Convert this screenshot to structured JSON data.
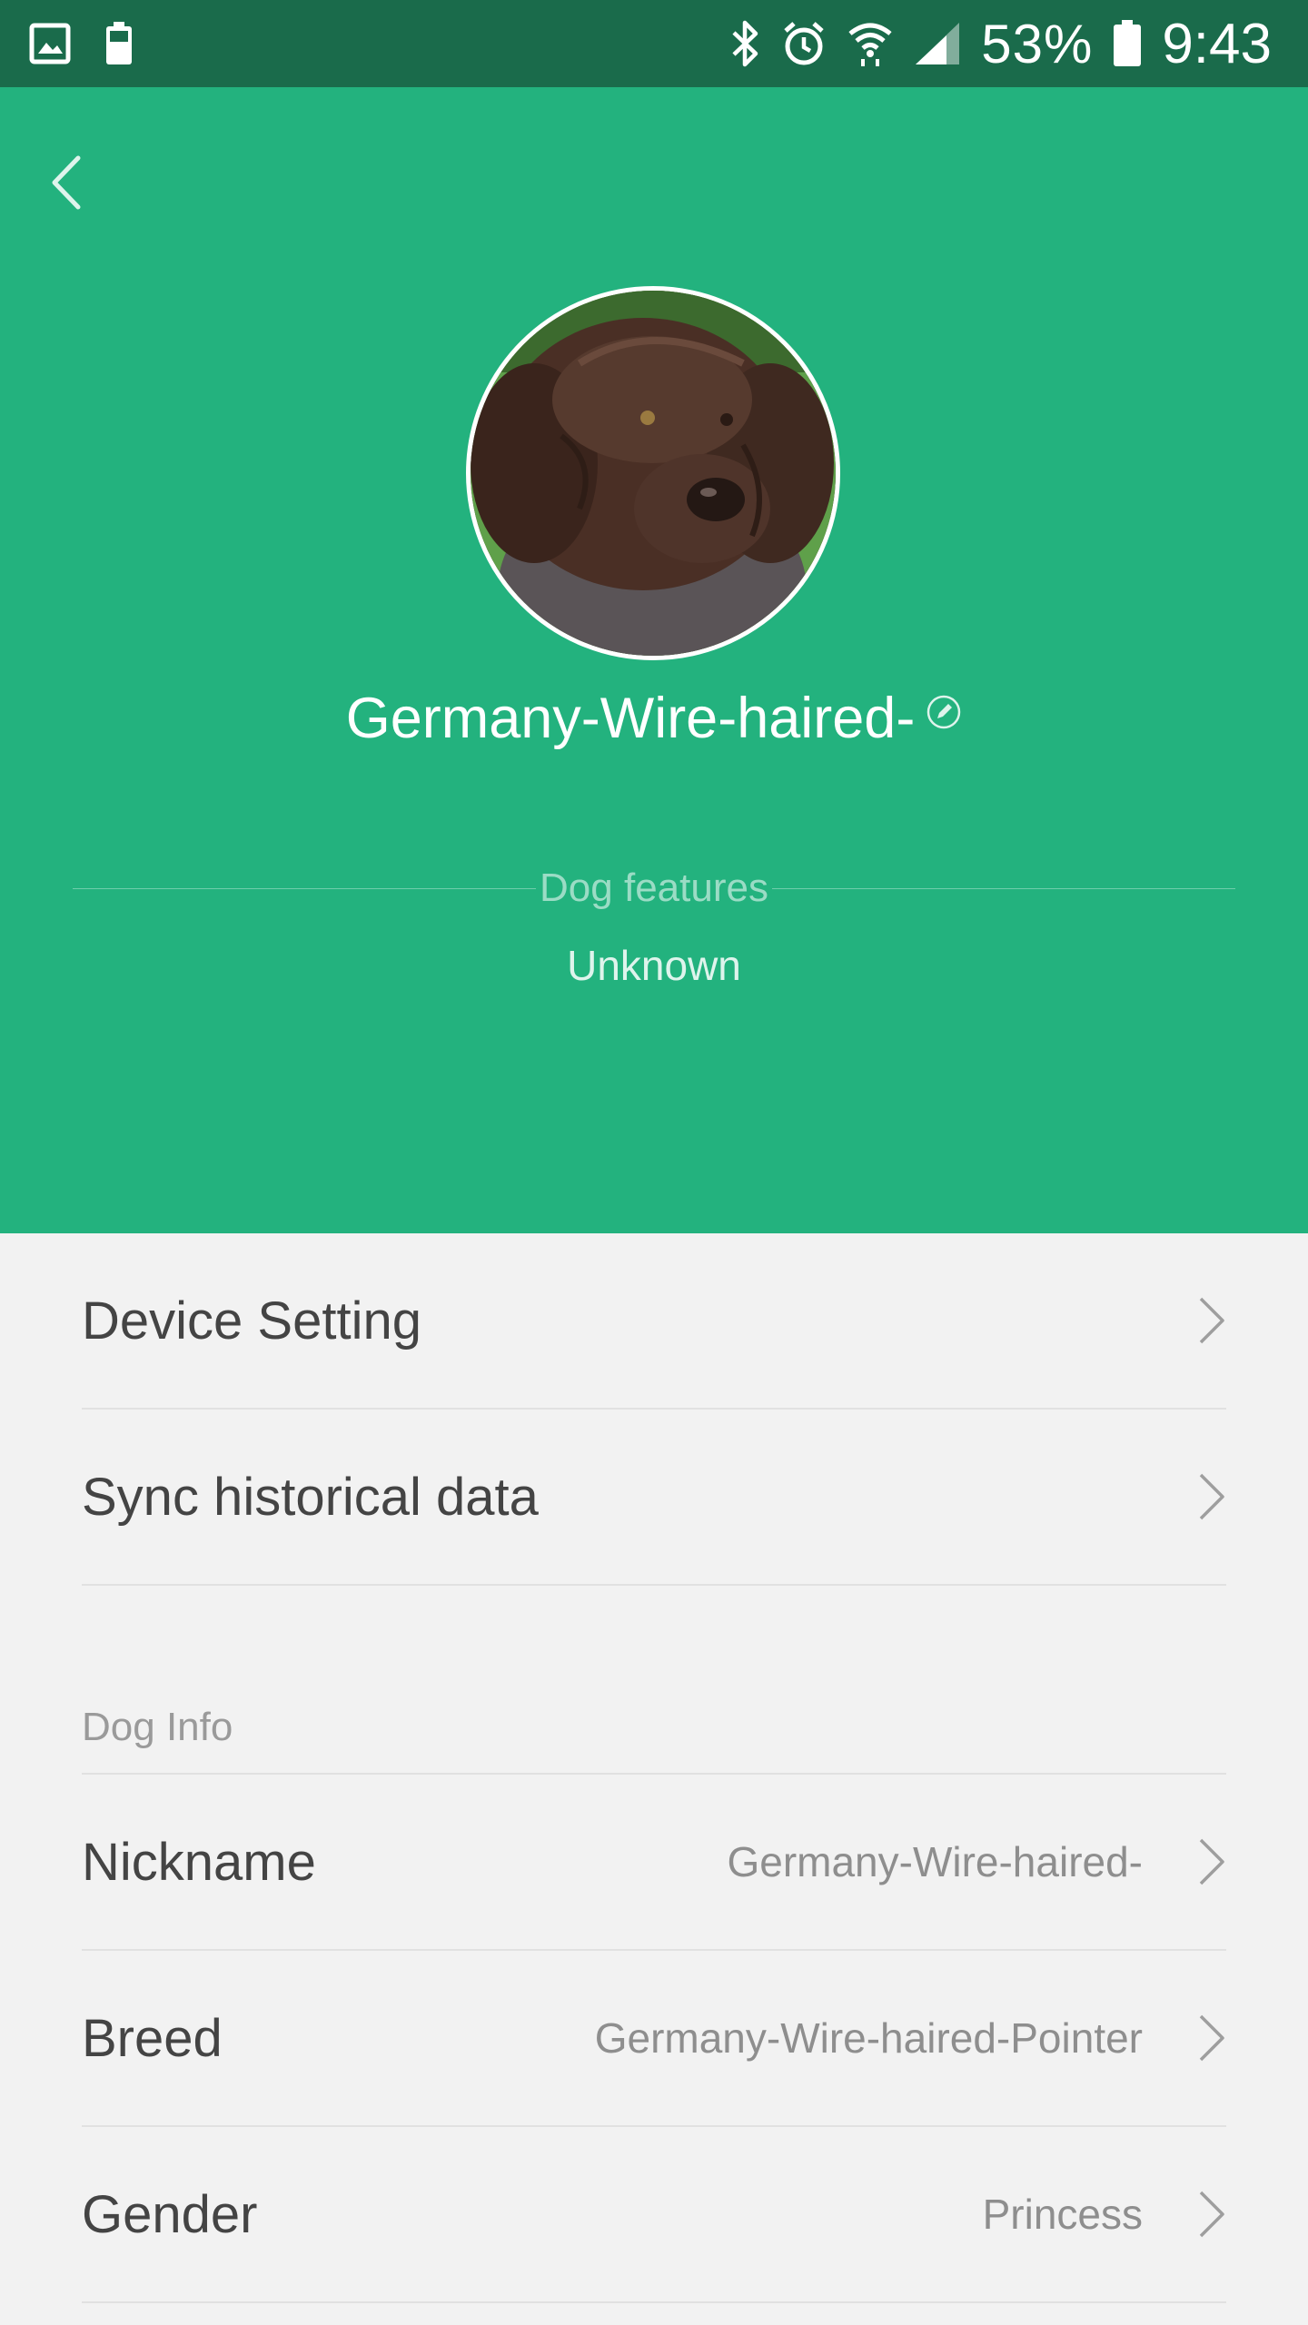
{
  "status_bar": {
    "battery_percent": "53%",
    "time": "9:43",
    "icons": [
      "gallery-icon",
      "battery-small-icon",
      "bluetooth-icon",
      "alarm-icon",
      "wifi-icon",
      "signal-icon",
      "battery-icon"
    ]
  },
  "header": {
    "background_color": "#23b27e",
    "pet_name": "Germany-Wire-haired-",
    "features_label": "Dog features",
    "features_value": "Unknown"
  },
  "list": {
    "device_setting": "Device Setting",
    "sync_historical_data": "Sync historical data",
    "dog_info_header": "Dog Info",
    "nickname_label": "Nickname",
    "nickname_value": "Germany-Wire-haired-",
    "breed_label": "Breed",
    "breed_value": "Germany-Wire-haired-Pointer",
    "gender_label": "Gender",
    "gender_value": "Princess"
  }
}
